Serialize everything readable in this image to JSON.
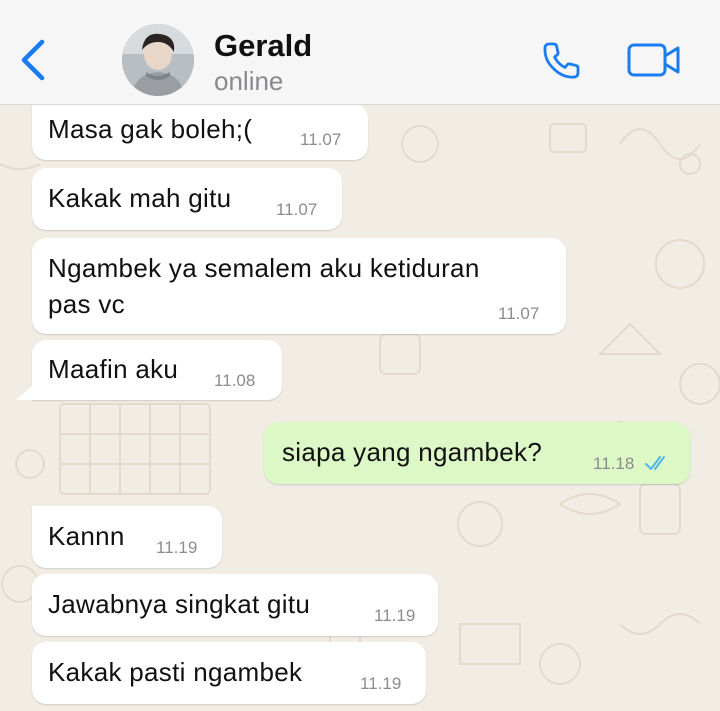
{
  "header": {
    "contact_name": "Gerald",
    "status": "online",
    "back_icon": "chevron-left-icon",
    "call_icon": "phone-icon",
    "video_icon": "video-camera-icon",
    "accent_color": "#1a7cf0"
  },
  "messages": [
    {
      "direction": "in",
      "text": "Masa gak boleh;(",
      "time": "11.07"
    },
    {
      "direction": "in",
      "text": "Kakak mah gitu",
      "time": "11.07"
    },
    {
      "direction": "in",
      "text_line1": "Ngambek ya semalem aku ketiduran",
      "text_line2": "pas vc",
      "time": "11.07"
    },
    {
      "direction": "in",
      "text": "Maafin aku",
      "time": "11.08"
    },
    {
      "direction": "out",
      "text": "siapa yang ngambek?",
      "time": "11.18",
      "status": "read"
    },
    {
      "direction": "in",
      "text": "Kannn",
      "time": "11.19"
    },
    {
      "direction": "in",
      "text": "Jawabnya singkat gitu",
      "time": "11.19"
    },
    {
      "direction": "in",
      "text": "Kakak pasti ngambek",
      "time": "11.19"
    }
  ],
  "colors": {
    "incoming_bubble": "#ffffff",
    "outgoing_bubble": "#dcf8c6",
    "chat_background": "#f2ede4",
    "read_ticks": "#4fb6ec"
  }
}
